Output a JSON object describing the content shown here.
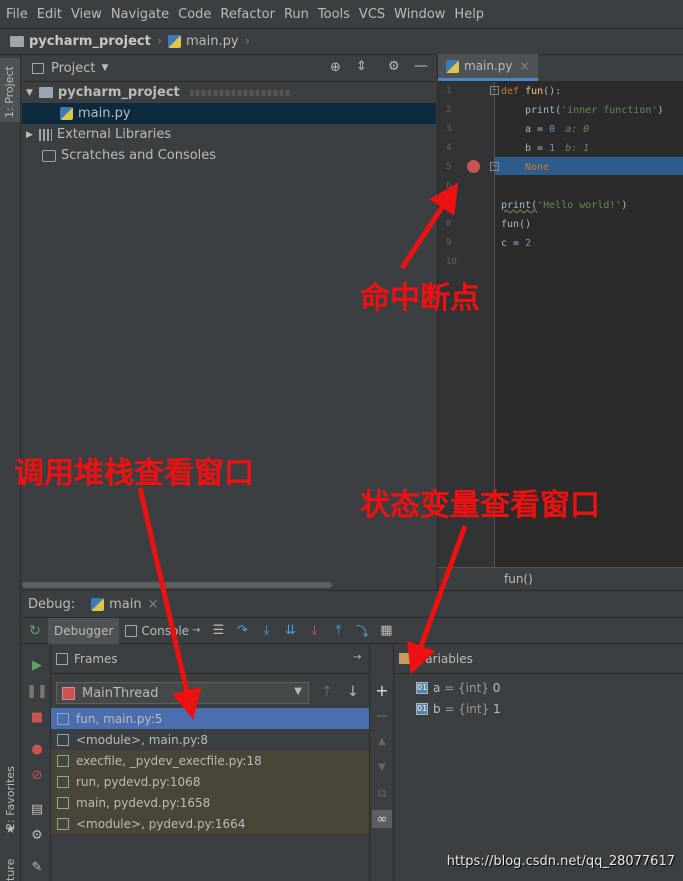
{
  "menu": [
    "File",
    "Edit",
    "View",
    "Navigate",
    "Code",
    "Refactor",
    "Run",
    "Tools",
    "VCS",
    "Window",
    "Help"
  ],
  "nav": {
    "project": "pycharm_project",
    "file": "main.py"
  },
  "left_strip": {
    "project_label": "1: Project",
    "favorites_label": "2: Favorites",
    "structure_label": "ture"
  },
  "project_pane": {
    "title": "Project",
    "tree": [
      {
        "label": "pycharm_project",
        "bold": true
      },
      {
        "label": "main.py",
        "selected": true
      },
      {
        "label": "External Libraries"
      },
      {
        "label": "Scratches and Consoles"
      }
    ]
  },
  "editor": {
    "tab": "main.py",
    "line_numbers": [
      "1",
      "2",
      "3",
      "4",
      "5",
      "6",
      "7",
      "8",
      "9",
      "10"
    ],
    "code": {
      "l1_kw": "def ",
      "l1_fn": "fun",
      "l1_rest": "():",
      "l2": "print(",
      "l2_str": "'inner function'",
      "l2_end": ")",
      "l3": "a = ",
      "l3_num": "0",
      "l3_hint": "a: 0",
      "l4": "b = ",
      "l4_num": "1",
      "l4_hint": "b: 1",
      "l5": "None",
      "l7": "print(",
      "l7_str": "'Hello world!'",
      "l7_end": ")",
      "l8": "fun()",
      "l9": "c = ",
      "l9_num": "2"
    },
    "breadcrumb": "fun()"
  },
  "debug": {
    "title": "Debug:",
    "config": "main",
    "tabs": {
      "debugger": "Debugger",
      "console": "Console"
    },
    "frames_title": "Frames",
    "variables_title": "Variables",
    "thread": "MainThread",
    "frames": [
      {
        "label": "fun, main.py:5",
        "state": "selected"
      },
      {
        "label": "<module>, main.py:8",
        "state": "normal"
      },
      {
        "label": "execfile, _pydev_execfile.py:18",
        "state": "library"
      },
      {
        "label": "run, pydevd.py:1068",
        "state": "library"
      },
      {
        "label": "main, pydevd.py:1658",
        "state": "library"
      },
      {
        "label": "<module>, pydevd.py:1664",
        "state": "library"
      }
    ],
    "variables": [
      {
        "name": "a",
        "type": " = {int} ",
        "value": "0"
      },
      {
        "name": "b",
        "type": " = {int} ",
        "value": "1"
      }
    ]
  },
  "annotations": {
    "breakpoint_hit": "命中断点",
    "call_stack": "调用堆栈查看窗口",
    "variables_window": "状态变量查看窗口"
  },
  "watermark": "https://blog.csdn.net/qq_28077617",
  "colors": {
    "accent": "#4a88c7",
    "breakpoint": "#c75450",
    "annotation": "#ee1111",
    "exec_line": "#2d5d8c"
  }
}
